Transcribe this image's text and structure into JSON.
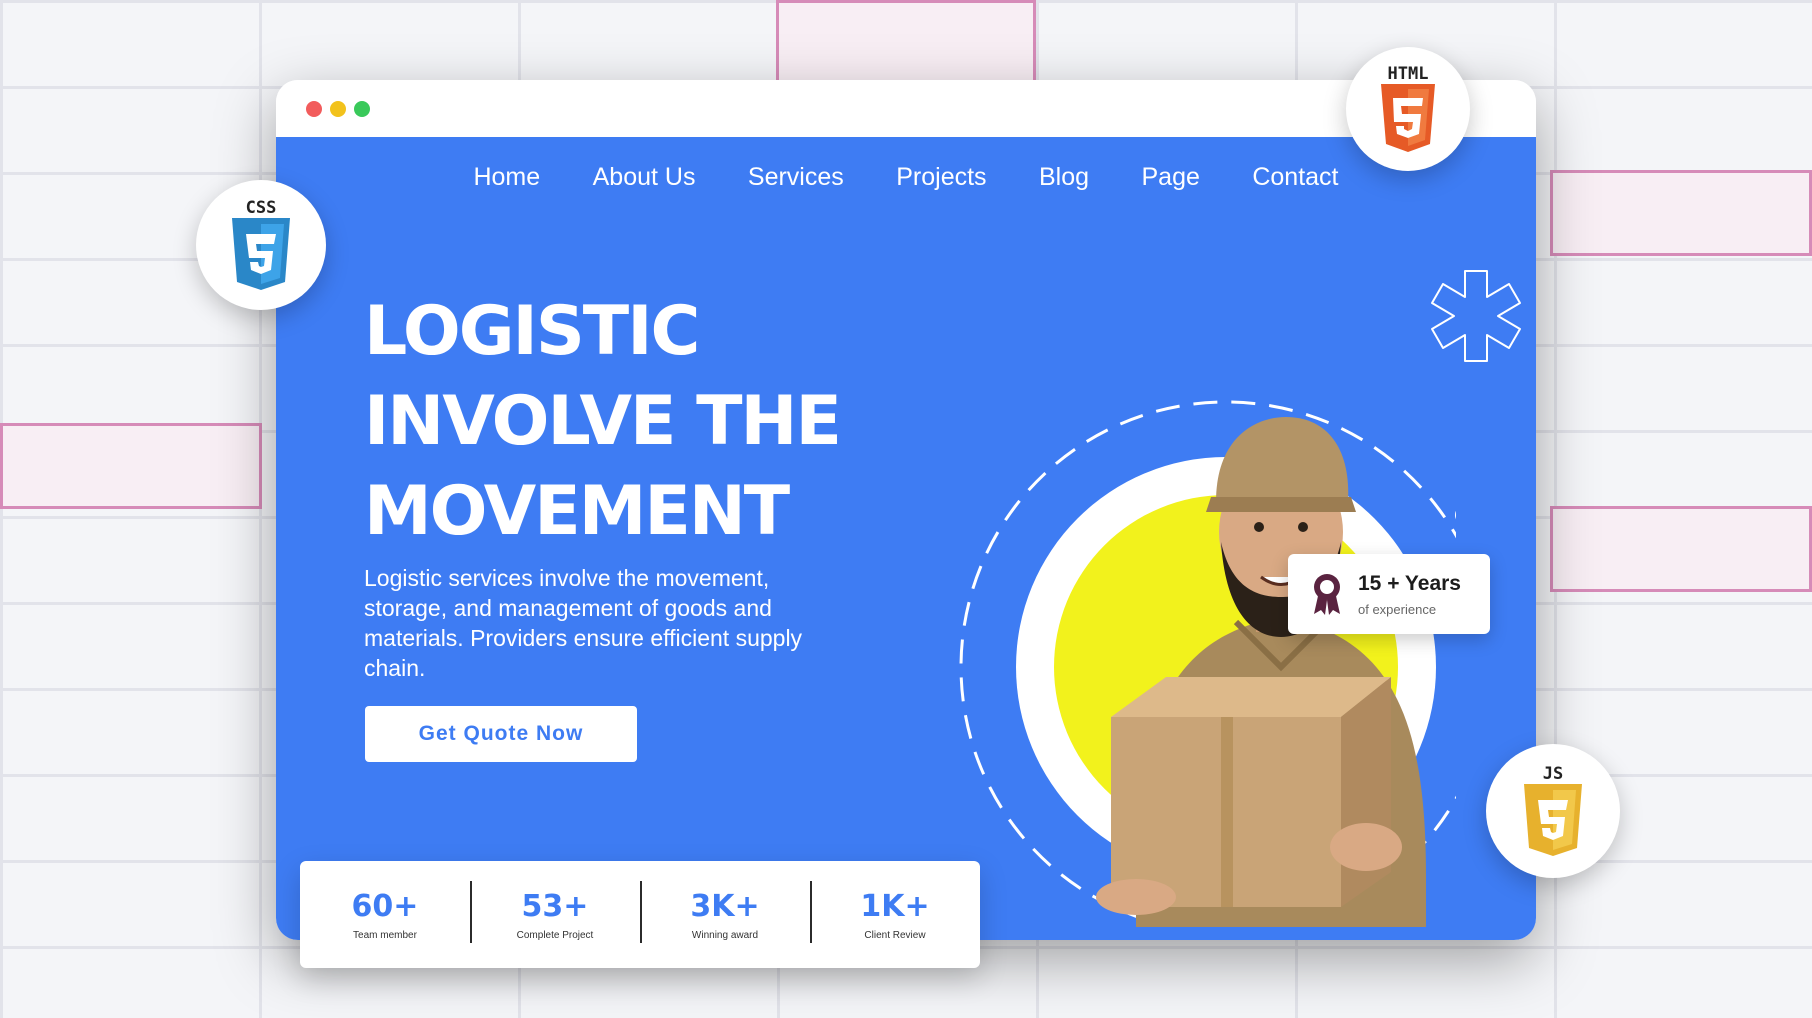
{
  "nav": {
    "items": [
      {
        "label": "Home"
      },
      {
        "label": "About Us"
      },
      {
        "label": "Services"
      },
      {
        "label": "Projects"
      },
      {
        "label": "Blog"
      },
      {
        "label": "Page"
      },
      {
        "label": "Contact"
      }
    ]
  },
  "hero": {
    "headline_lines": [
      "LOGISTIC",
      "INVOLVE THE",
      "MOVEMENT"
    ],
    "description": "Logistic services involve the movement, storage, and management of goods and materials. Providers ensure efficient supply chain.",
    "cta_label": "Get Quote Now"
  },
  "badge": {
    "title": "15 + Years",
    "subtitle": "of experience",
    "icon": "award-icon"
  },
  "stats": [
    {
      "value": "60+",
      "label": "Team member"
    },
    {
      "value": "53+",
      "label": "Complete Project"
    },
    {
      "value": "3K+",
      "label": "Winning award"
    },
    {
      "value": "1K+",
      "label": "Client Review"
    }
  ],
  "tech_logos": {
    "css": "CSS",
    "html": "HTML",
    "js": "JS"
  },
  "colors": {
    "hero_bg": "#3e7cf3",
    "accent_yellow": "#f2f21c",
    "html_orange": "#e65a26",
    "css_blue": "#2a87c8",
    "js_yellow": "#e7b12d",
    "dot_red": "#f25c5c",
    "dot_yellow": "#f2c21c",
    "dot_green": "#39c95a"
  }
}
